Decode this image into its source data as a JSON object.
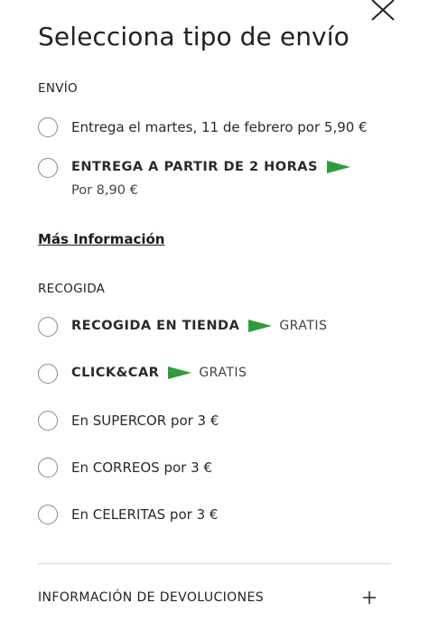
{
  "modal": {
    "title": "Selecciona tipo de envío",
    "close_icon": "close-icon"
  },
  "shipping": {
    "section_label": "ENVÍO",
    "options": [
      {
        "label": "Entrega el martes, 11 de febrero por 5,90 €",
        "selected": false
      },
      {
        "label": "ENTREGA A PARTIR DE 2 HORAS",
        "sublabel": "Por 8,90 €",
        "flag_icon": "green-flag-icon",
        "selected": false
      }
    ],
    "more_info_link": "Más Información"
  },
  "pickup": {
    "section_label": "RECOGIDA",
    "options": [
      {
        "label": "RECOGIDA EN TIENDA",
        "badge": "GRATIS",
        "flag_icon": "green-flag-icon",
        "selected": false
      },
      {
        "label": "CLICK&CAR",
        "badge": "GRATIS",
        "flag_icon": "green-flag-icon",
        "selected": false
      },
      {
        "label": "En SUPERCOR por 3 €",
        "selected": false
      },
      {
        "label": "En CORREOS por 3 €",
        "selected": false
      },
      {
        "label": "En CELERITAS por 3 €",
        "selected": false
      }
    ]
  },
  "returns": {
    "label": "INFORMACIÓN DE DEVOLUCIONES",
    "toggle_icon": "plus-icon"
  },
  "colors": {
    "flag_green": "#2e9b3b",
    "text": "#1c1c1c",
    "radio_border": "#8a8a8a",
    "divider": "#d9d9d9"
  }
}
